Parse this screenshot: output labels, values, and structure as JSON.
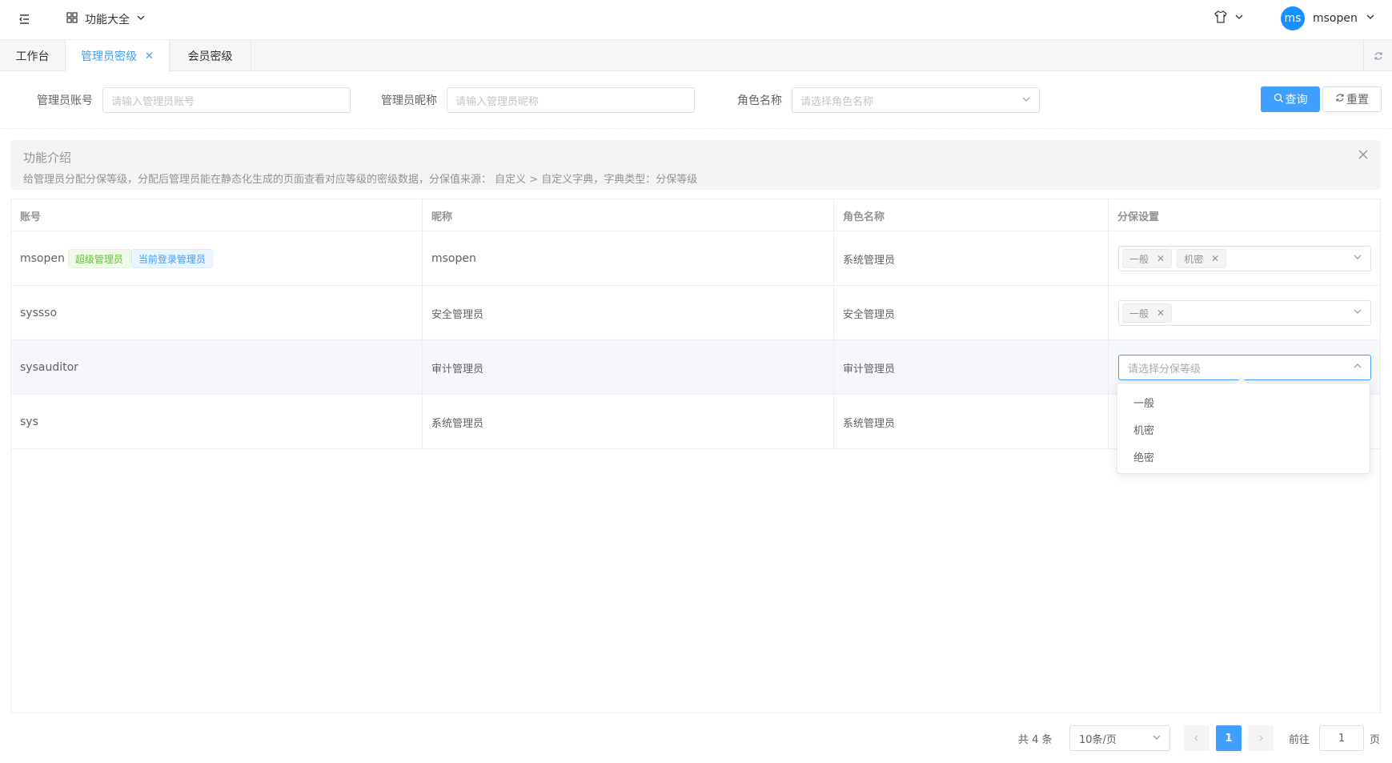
{
  "topbar": {
    "features_label": "功能大全",
    "username": "msopen",
    "avatar_text": "ms"
  },
  "tabs": [
    {
      "label": "工作台",
      "active": false
    },
    {
      "label": "管理员密级",
      "active": true
    },
    {
      "label": "会员密级",
      "active": false
    }
  ],
  "filters": {
    "account_label": "管理员账号",
    "account_placeholder": "请输入管理员账号",
    "nickname_label": "管理员昵称",
    "nickname_placeholder": "请输入管理员昵称",
    "role_label": "角色名称",
    "role_placeholder": "请选择角色名称",
    "search_button": "查询",
    "reset_button": "重置"
  },
  "alert": {
    "title": "功能介绍",
    "description": "给管理员分配分保等级，分配后管理员能在静态化生成的页面查看对应等级的密级数据，分保值来源： 自定义 > 自定义字典，字典类型：分保等级"
  },
  "table": {
    "columns": [
      "账号",
      "昵称",
      "角色名称",
      "分保设置"
    ],
    "rows": [
      {
        "account": "msopen",
        "tags": [
          "超级管理员",
          "当前登录管理员"
        ],
        "nickname": "msopen",
        "role": "系统管理员",
        "levels": [
          "一般",
          "机密"
        ],
        "placeholder": ""
      },
      {
        "account": "syssso",
        "tags": [],
        "nickname": "安全管理员",
        "role": "安全管理员",
        "levels": [
          "一般"
        ],
        "placeholder": ""
      },
      {
        "account": "sysauditor",
        "tags": [],
        "nickname": "审计管理员",
        "role": "审计管理员",
        "levels": [],
        "placeholder": "请选择分保等级"
      },
      {
        "account": "sys",
        "tags": [],
        "nickname": "系统管理员",
        "role": "系统管理员",
        "levels": [],
        "placeholder": ""
      }
    ]
  },
  "dropdown": {
    "options": [
      "一般",
      "机密",
      "绝密"
    ]
  },
  "pagination": {
    "total_text": "共 4 条",
    "page_size": "10条/页",
    "current_page": "1",
    "goto_prefix": "前往",
    "goto_value": "1",
    "goto_suffix": "页"
  },
  "colors": {
    "primary": "#409eff",
    "success": "#67c23a"
  }
}
